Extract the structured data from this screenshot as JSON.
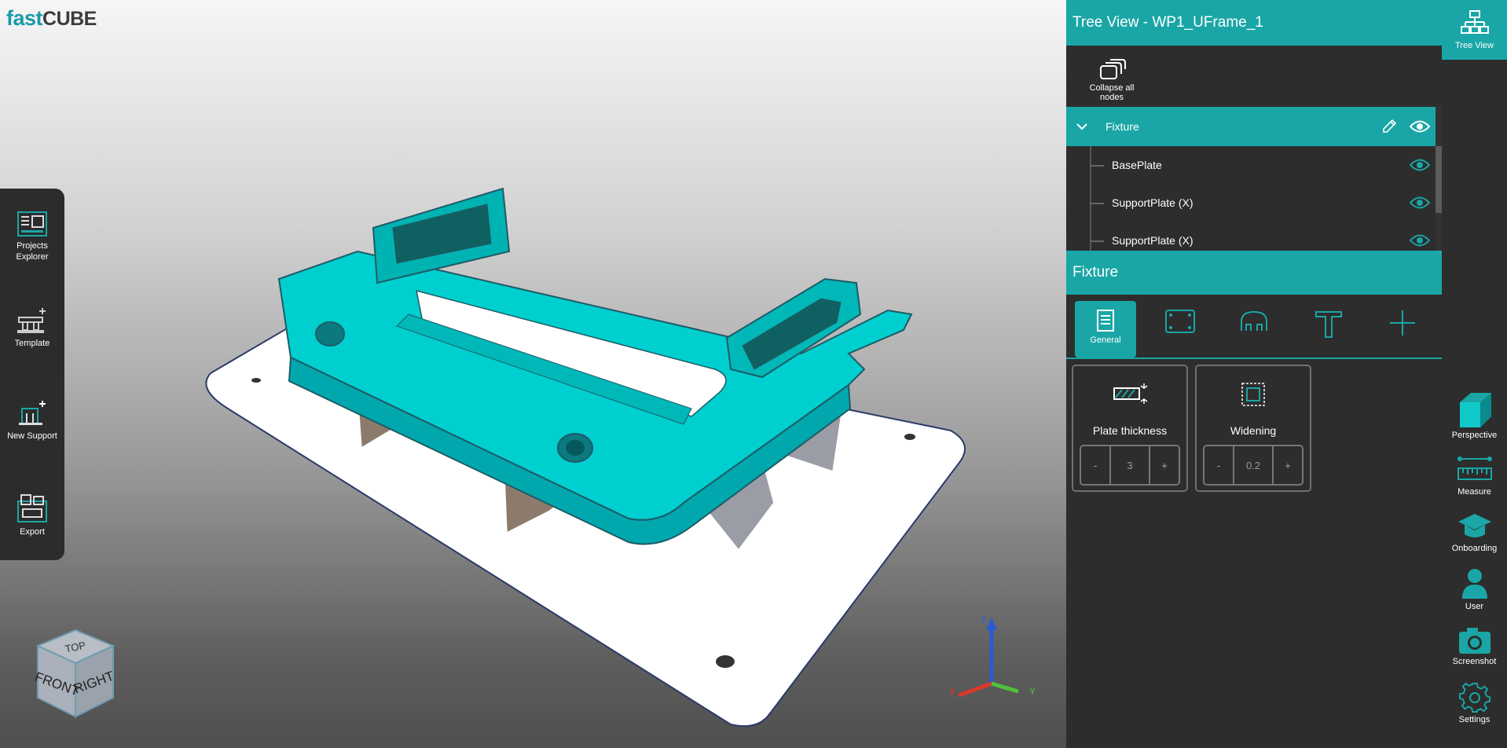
{
  "app": {
    "logo_part1": "fast",
    "logo_part2": "CUBE"
  },
  "left_toolbar": {
    "items": [
      {
        "label": "Projects Explorer"
      },
      {
        "label": "Template"
      },
      {
        "label": "New Support"
      },
      {
        "label": "Export"
      }
    ]
  },
  "view_cube": {
    "top": "TOP",
    "front": "FRONT",
    "right": "RIGHT"
  },
  "axis_gizmo": {
    "x": "X",
    "y": "Y",
    "z": "Z"
  },
  "tree_panel": {
    "title": "Tree View - WP1_UFrame_1",
    "collapse_label": "Collapse all nodes",
    "nodes": [
      {
        "label": "Fixture"
      },
      {
        "label": "BasePlate"
      },
      {
        "label": "SupportPlate (X)"
      },
      {
        "label": "SupportPlate (X)"
      }
    ]
  },
  "detail_panel": {
    "title": "Fixture",
    "tabs": [
      {
        "label": "General",
        "icon": "document-icon"
      },
      {
        "label": "",
        "icon": "plate-icon"
      },
      {
        "label": "",
        "icon": "clamp-icon"
      },
      {
        "label": "",
        "icon": "t-profile-icon"
      },
      {
        "label": "",
        "icon": "plus-icon"
      }
    ],
    "properties": [
      {
        "label": "Plate thickness",
        "value": "3",
        "minus": "-",
        "plus": "+"
      },
      {
        "label": "Widening",
        "value": "0.2",
        "minus": "-",
        "plus": "+"
      }
    ]
  },
  "right_toolbar": {
    "items": [
      {
        "label": "Tree View"
      },
      {
        "label": "Perspective"
      },
      {
        "label": "Measure"
      },
      {
        "label": "Onboarding"
      },
      {
        "label": "User"
      },
      {
        "label": "Screenshot"
      },
      {
        "label": "Settings"
      }
    ]
  },
  "colors": {
    "accent": "#1aa6a6",
    "panel_bg": "#2d2d2d",
    "model_teal": "#00c8c8"
  }
}
